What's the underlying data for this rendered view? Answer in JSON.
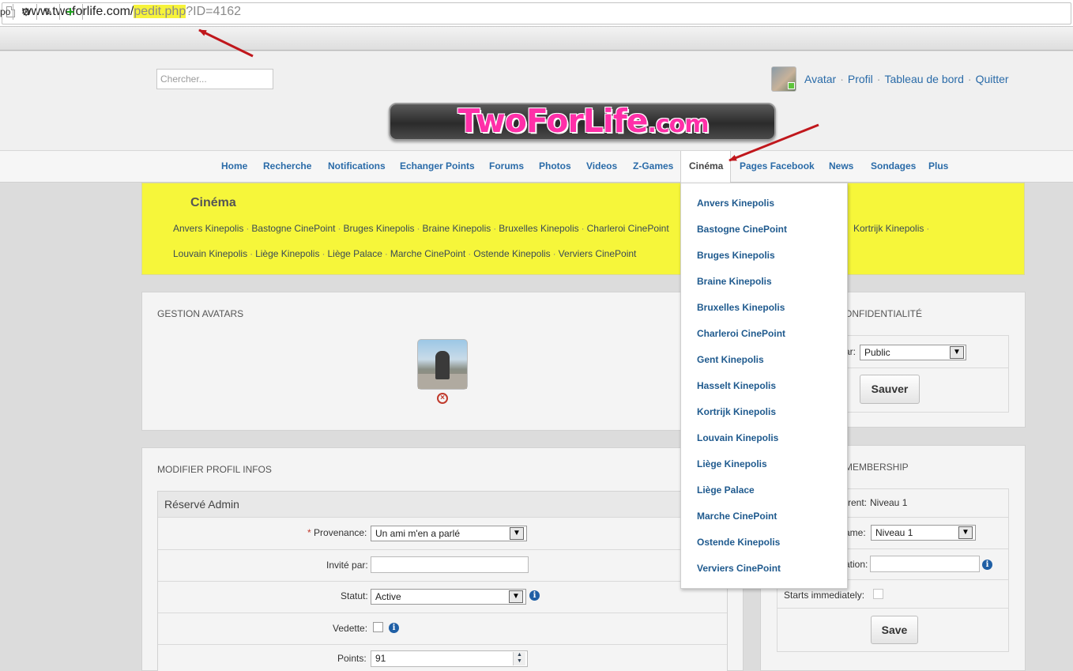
{
  "browser": {
    "url_host": "www.twoforlife.com/",
    "url_path": "pedit.php",
    "url_query": "?ID=4162",
    "toolbar": {
      "partial_label": "po",
      "gear_icon": "gear-icon",
      "edit_icon": "edit-icon",
      "add_icon": "plus-icon"
    }
  },
  "header": {
    "search_placeholder": "Chercher...",
    "logo_text_main": "TwoForLife",
    "logo_text_suffix": ".com",
    "user_links": [
      "Avatar",
      "Profil",
      "Tableau de bord",
      "Quitter"
    ]
  },
  "nav": {
    "items": [
      "Home",
      "Recherche",
      "Notifications",
      "Echanger Points",
      "Forums",
      "Photos",
      "Videos",
      "Z-Games",
      "Cinéma",
      "Pages Facebook",
      "News",
      "Sondages",
      "Plus"
    ],
    "active": "Cinéma"
  },
  "cinema_panel": {
    "title": "Cinéma",
    "line1": [
      "Anvers Kinepolis",
      "Bastogne CinePoint",
      "Bruges Kinepolis",
      "Braine Kinepolis",
      "Bruxelles Kinepolis",
      "Charleroi CinePoint"
    ],
    "line1_tail": "Kortrijk Kinepolis",
    "line2": [
      "Louvain Kinepolis",
      "Liège Kinepolis",
      "Liège Palace",
      "Marche CinePoint",
      "Ostende Kinepolis",
      "Verviers CinePoint"
    ]
  },
  "dropdown": {
    "items": [
      "Anvers Kinepolis",
      "Bastogne CinePoint",
      "Bruges Kinepolis",
      "Braine Kinepolis",
      "Bruxelles Kinepolis",
      "Charleroi CinePoint",
      "Gent Kinepolis",
      "Hasselt Kinepolis",
      "Kortrijk Kinepolis",
      "Louvain Kinepolis",
      "Liège Kinepolis",
      "Liège Palace",
      "Marche CinePoint",
      "Ostende Kinepolis",
      "Verviers CinePoint"
    ]
  },
  "avatars_box": {
    "title": "GESTION AVATARS"
  },
  "privacy_box": {
    "title_visible": "ONFIDENTIALITÉ",
    "field_label_visible": "ar:",
    "field_value": "Public",
    "save_label": "Sauver"
  },
  "profile_box": {
    "title": "MODIFIER PROFIL INFOS",
    "section": "Réservé Admin",
    "fields": {
      "provenance": {
        "label": "Provenance:",
        "required": "*",
        "value": "Un ami m'en a parlé"
      },
      "invite": {
        "label": "Invité par:",
        "value": ""
      },
      "statut": {
        "label": "Statut:",
        "value": "Active"
      },
      "vedette": {
        "label": "Vedette:"
      },
      "points": {
        "label": "Points:",
        "value": "91"
      }
    }
  },
  "membership_box": {
    "title_visible": "MEMBERSHIP",
    "current_label_visible": "rrent:",
    "current_value": "Niveau 1",
    "name_label_visible": "ame:",
    "name_value": "Niveau 1",
    "duration_label_visible": "ation:",
    "starts_label": "Starts immediately:",
    "save_label": "Save"
  }
}
